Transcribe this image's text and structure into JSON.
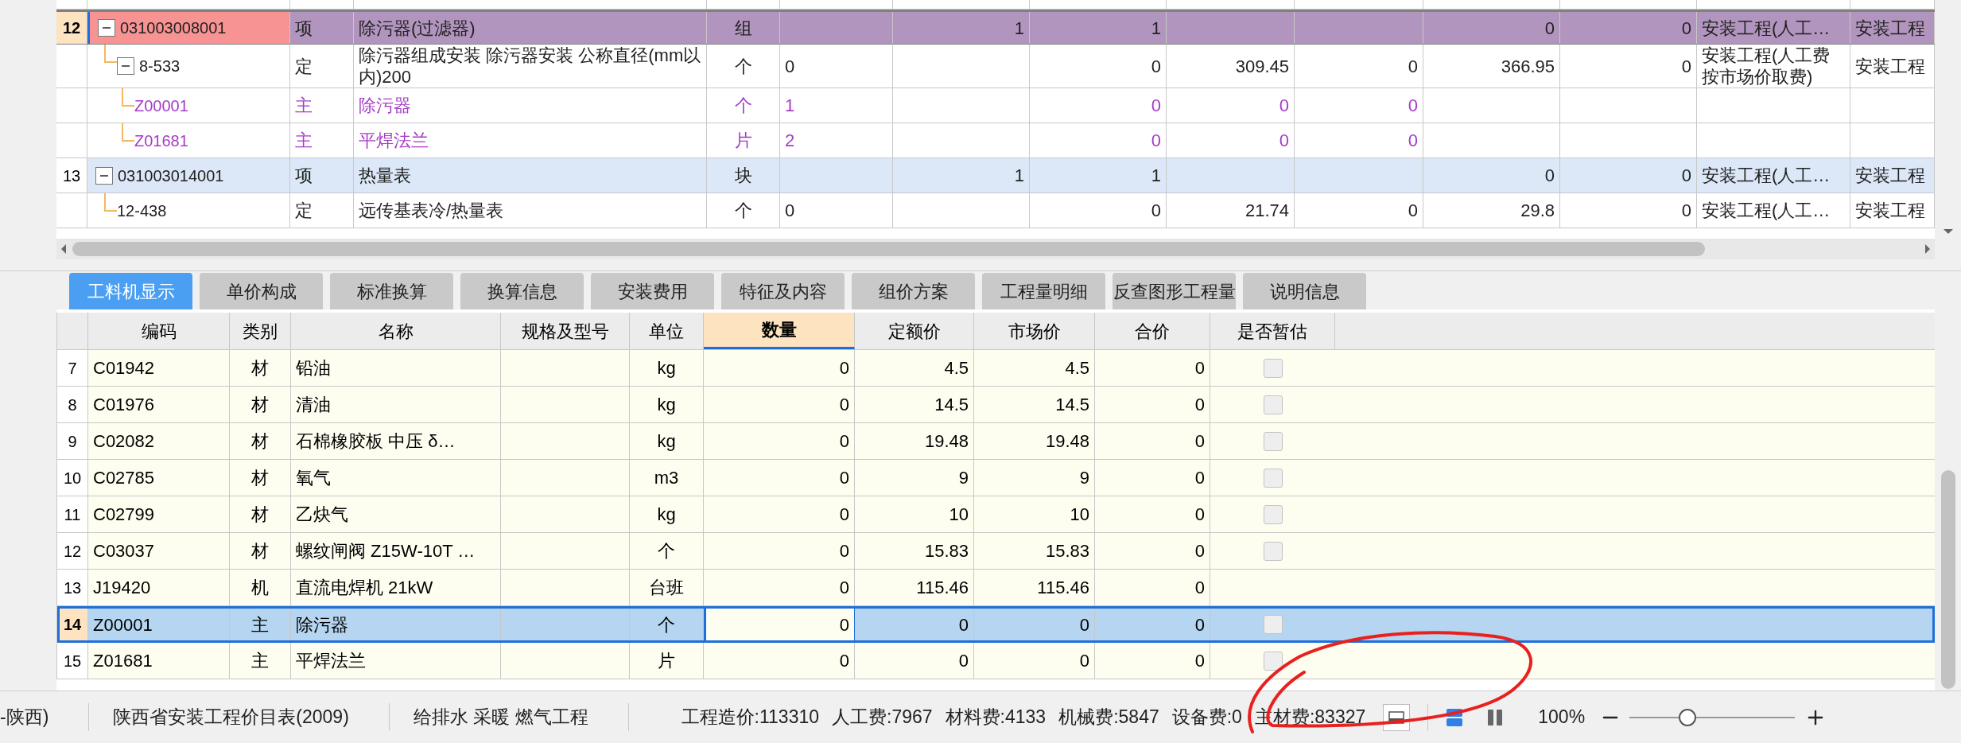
{
  "tree_table": {
    "rows": [
      {
        "number": "12",
        "code": "031003008001",
        "kind": "item",
        "selected": true,
        "expanded": true,
        "cells": [
          "项",
          "除污器(过滤器)",
          "组",
          "",
          "1",
          "1",
          "",
          "",
          "0",
          "0",
          "安装工程(人工…",
          "安装工程"
        ],
        "children": [
          {
            "code": "8-533",
            "kind": "quota",
            "selected": false,
            "expanded": true,
            "cells": [
              "定",
              "除污器组成安装 除污器安装 公称直径(mm以内)200",
              "个",
              "0",
              "",
              "0",
              "309.45",
              "0",
              "366.95",
              "0",
              "安装工程(人工费按市场价取费)",
              "安装工程"
            ],
            "children": [
              {
                "code": "Z00001",
                "kind": "material",
                "selected": false,
                "cells": [
                  "主",
                  "除污器",
                  "个",
                  "1",
                  "",
                  "0",
                  "0",
                  "0",
                  "",
                  "",
                  "",
                  ""
                ]
              },
              {
                "code": "Z01681",
                "kind": "material",
                "selected": false,
                "cells": [
                  "主",
                  "平焊法兰",
                  "片",
                  "2",
                  "",
                  "0",
                  "0",
                  "0",
                  "",
                  "",
                  "",
                  ""
                ]
              }
            ]
          }
        ]
      },
      {
        "number": "13",
        "code": "031003014001",
        "kind": "item",
        "selected": false,
        "expanded": true,
        "cells": [
          "项",
          "热量表",
          "块",
          "",
          "1",
          "1",
          "",
          "",
          "0",
          "0",
          "安装工程(人工…",
          "安装工程"
        ],
        "children": [
          {
            "code": "12-438",
            "kind": "quota",
            "selected": false,
            "cells": [
              "定",
              "远传基表冷/热量表",
              "个",
              "0",
              "",
              "0",
              "21.74",
              "0",
              "29.8",
              "0",
              "安装工程(人工…",
              "安装工程"
            ]
          }
        ]
      }
    ]
  },
  "tabs": [
    {
      "label": "工料机显示",
      "selected": true
    },
    {
      "label": "单价构成",
      "selected": false
    },
    {
      "label": "标准换算",
      "selected": false
    },
    {
      "label": "换算信息",
      "selected": false
    },
    {
      "label": "安装费用",
      "selected": false
    },
    {
      "label": "特征及内容",
      "selected": false
    },
    {
      "label": "组价方案",
      "selected": false
    },
    {
      "label": "工程量明细",
      "selected": false
    },
    {
      "label": "反查图形工程量",
      "selected": false
    },
    {
      "label": "说明信息",
      "selected": false
    }
  ],
  "detail_table": {
    "columns": [
      {
        "label": "编码",
        "selected": false
      },
      {
        "label": "类别",
        "selected": false
      },
      {
        "label": "名称",
        "selected": false
      },
      {
        "label": "规格及型号",
        "selected": false
      },
      {
        "label": "单位",
        "selected": false
      },
      {
        "label": "数量",
        "selected": true
      },
      {
        "label": "定额价",
        "selected": false
      },
      {
        "label": "市场价",
        "selected": false
      },
      {
        "label": "合价",
        "selected": false
      },
      {
        "label": "是否暂估",
        "selected": false
      }
    ],
    "rows": [
      {
        "number": "7",
        "selected": false,
        "estimated": false,
        "cells": [
          "C01942",
          "材",
          "铅油",
          "",
          "kg",
          "0",
          "4.5",
          "4.5",
          "0"
        ]
      },
      {
        "number": "8",
        "selected": false,
        "estimated": false,
        "cells": [
          "C01976",
          "材",
          "清油",
          "",
          "kg",
          "0",
          "14.5",
          "14.5",
          "0"
        ]
      },
      {
        "number": "9",
        "selected": false,
        "estimated": false,
        "cells": [
          "C02082",
          "材",
          "石棉橡胶板 中压 δ…",
          "",
          "kg",
          "0",
          "19.48",
          "19.48",
          "0"
        ]
      },
      {
        "number": "10",
        "selected": false,
        "estimated": false,
        "cells": [
          "C02785",
          "材",
          "氧气",
          "",
          "m3",
          "0",
          "9",
          "9",
          "0"
        ]
      },
      {
        "number": "11",
        "selected": false,
        "estimated": false,
        "cells": [
          "C02799",
          "材",
          "乙炔气",
          "",
          "kg",
          "0",
          "10",
          "10",
          "0"
        ]
      },
      {
        "number": "12",
        "selected": false,
        "estimated": false,
        "cells": [
          "C03037",
          "材",
          "螺纹闸阀 Z15W-10T …",
          "",
          "个",
          "0",
          "15.83",
          "15.83",
          "0"
        ]
      },
      {
        "number": "13",
        "selected": false,
        "cells": [
          "J19420",
          "机",
          "直流电焊机 21kW",
          "",
          "台班",
          "0",
          "115.46",
          "115.46",
          "0"
        ]
      },
      {
        "number": "14",
        "selected": true,
        "estimated": false,
        "cells": [
          "Z00001",
          "主",
          "除污器",
          "",
          "个",
          "0",
          "0",
          "0",
          "0"
        ]
      },
      {
        "number": "15",
        "selected": false,
        "estimated": false,
        "cells": [
          "Z01681",
          "主",
          "平焊法兰",
          "",
          "片",
          "0",
          "0",
          "0",
          "0"
        ]
      }
    ]
  },
  "status_bar": {
    "segments": [
      "-陕西)",
      "陕西省安装工程价目表(2009)",
      "给排水 采暖 燃气工程"
    ],
    "costs": [
      "工程造价:113310",
      "人工费:7967",
      "材料费:4133",
      "机械费:5847",
      "设备费:0",
      "主材费:83327"
    ],
    "zoom": {
      "reading": "100%",
      "level": 0.35
    }
  }
}
